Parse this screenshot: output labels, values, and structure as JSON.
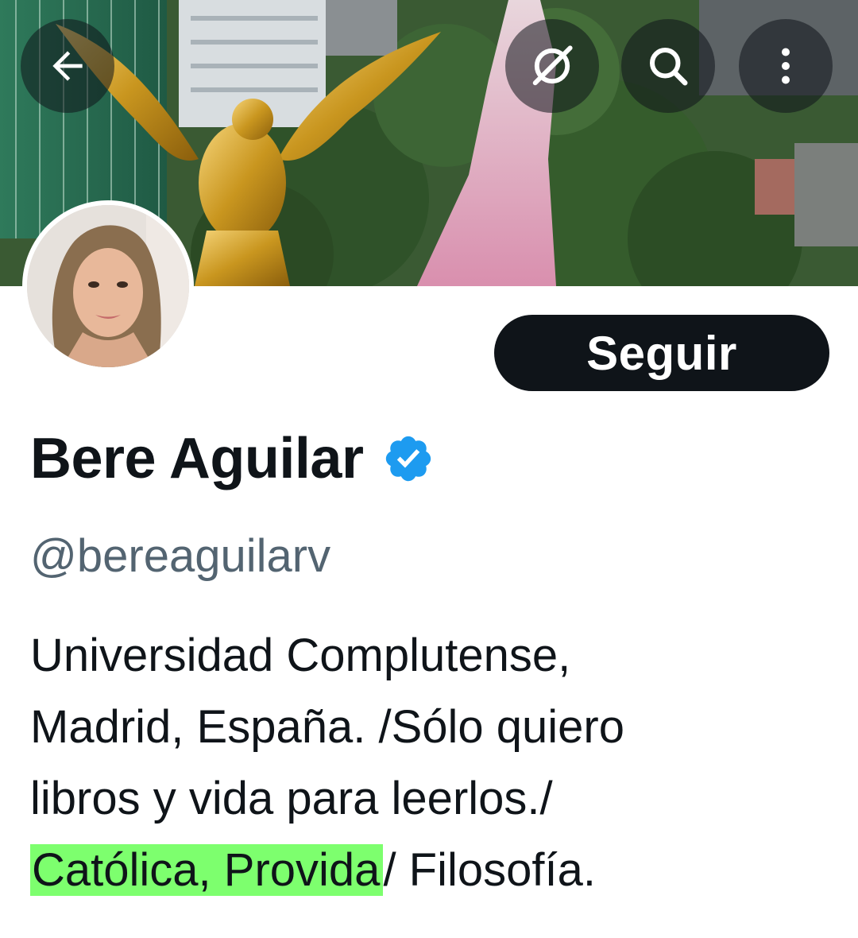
{
  "header": {
    "back_icon": "arrow-left-icon",
    "grok_icon": "grok-icon",
    "search_icon": "search-icon",
    "more_icon": "more-vertical-icon"
  },
  "profile": {
    "display_name": "Bere Aguilar",
    "verified": true,
    "verified_icon": "verified-badge-icon",
    "verified_color": "#1d9bf0",
    "handle": "@bereaguilarv",
    "follow_label": "Seguir",
    "bio": {
      "line1": "Universidad Complutense,",
      "line2": "Madrid, España. /Sólo quiero",
      "line3": "libros y vida para leerlos./",
      "line4_highlight": "Católica, Provida",
      "line4_rest": "/ Filosofía."
    }
  },
  "colors": {
    "text_primary": "#0f1419",
    "text_secondary": "#536471",
    "button_bg": "#0f1419",
    "highlight": "#7dff6e"
  }
}
